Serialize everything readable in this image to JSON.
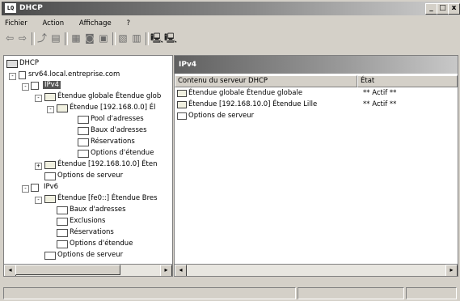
{
  "window": {
    "app_icon": "LQ",
    "title": "DHCP",
    "controls": [
      "_",
      "□",
      "x"
    ]
  },
  "menu": [
    "Fichier",
    "Action",
    "Affichage",
    "?"
  ],
  "toolbar": {
    "icons": [
      "back-icon",
      "forward-icon",
      "up-icon",
      "show-tree-icon",
      "properties-icon",
      "refresh-icon",
      "export-icon",
      "help-icon",
      "console-icon",
      "server-add-icon",
      "server-remove-icon"
    ]
  },
  "tree": {
    "root": "DHCP",
    "server": "srv64.local.entreprise.com",
    "ipv4": "IPv4",
    "superscope": "Étendue globale Étendue glob",
    "scope_192_168_0": "Étendue [192.168.0.0] Él",
    "pool": "Pool d'adresses",
    "leases": "Baux d'adresses",
    "reservations": "Réservations",
    "scope_options": "Options d'étendue",
    "scope_192_168_10": "Étendue [192.168.10.0] Éten",
    "server_options": "Options de serveur",
    "ipv6": "IPv6",
    "scope_fe0": "Étendue [fe0::] Étendue Bres",
    "v6_leases": "Baux d'adresses",
    "v6_exclusions": "Exclusions",
    "v6_reservations": "Réservations",
    "v6_scope_options": "Options d'étendue",
    "v6_server_options": "Options de serveur"
  },
  "details": {
    "header": "IPv4",
    "columns": [
      "Contenu du serveur DHCP",
      "État"
    ],
    "rows": [
      {
        "name": "Étendue globale Étendue globale",
        "state": "** Actif **"
      },
      {
        "name": "Étendue [192.168.10.0] Étendue Lille",
        "state": "** Actif **"
      },
      {
        "name": "Options de serveur",
        "state": ""
      }
    ]
  },
  "colors": {
    "selection": "#555555",
    "title_gradient_start": "#4a4a4a"
  }
}
